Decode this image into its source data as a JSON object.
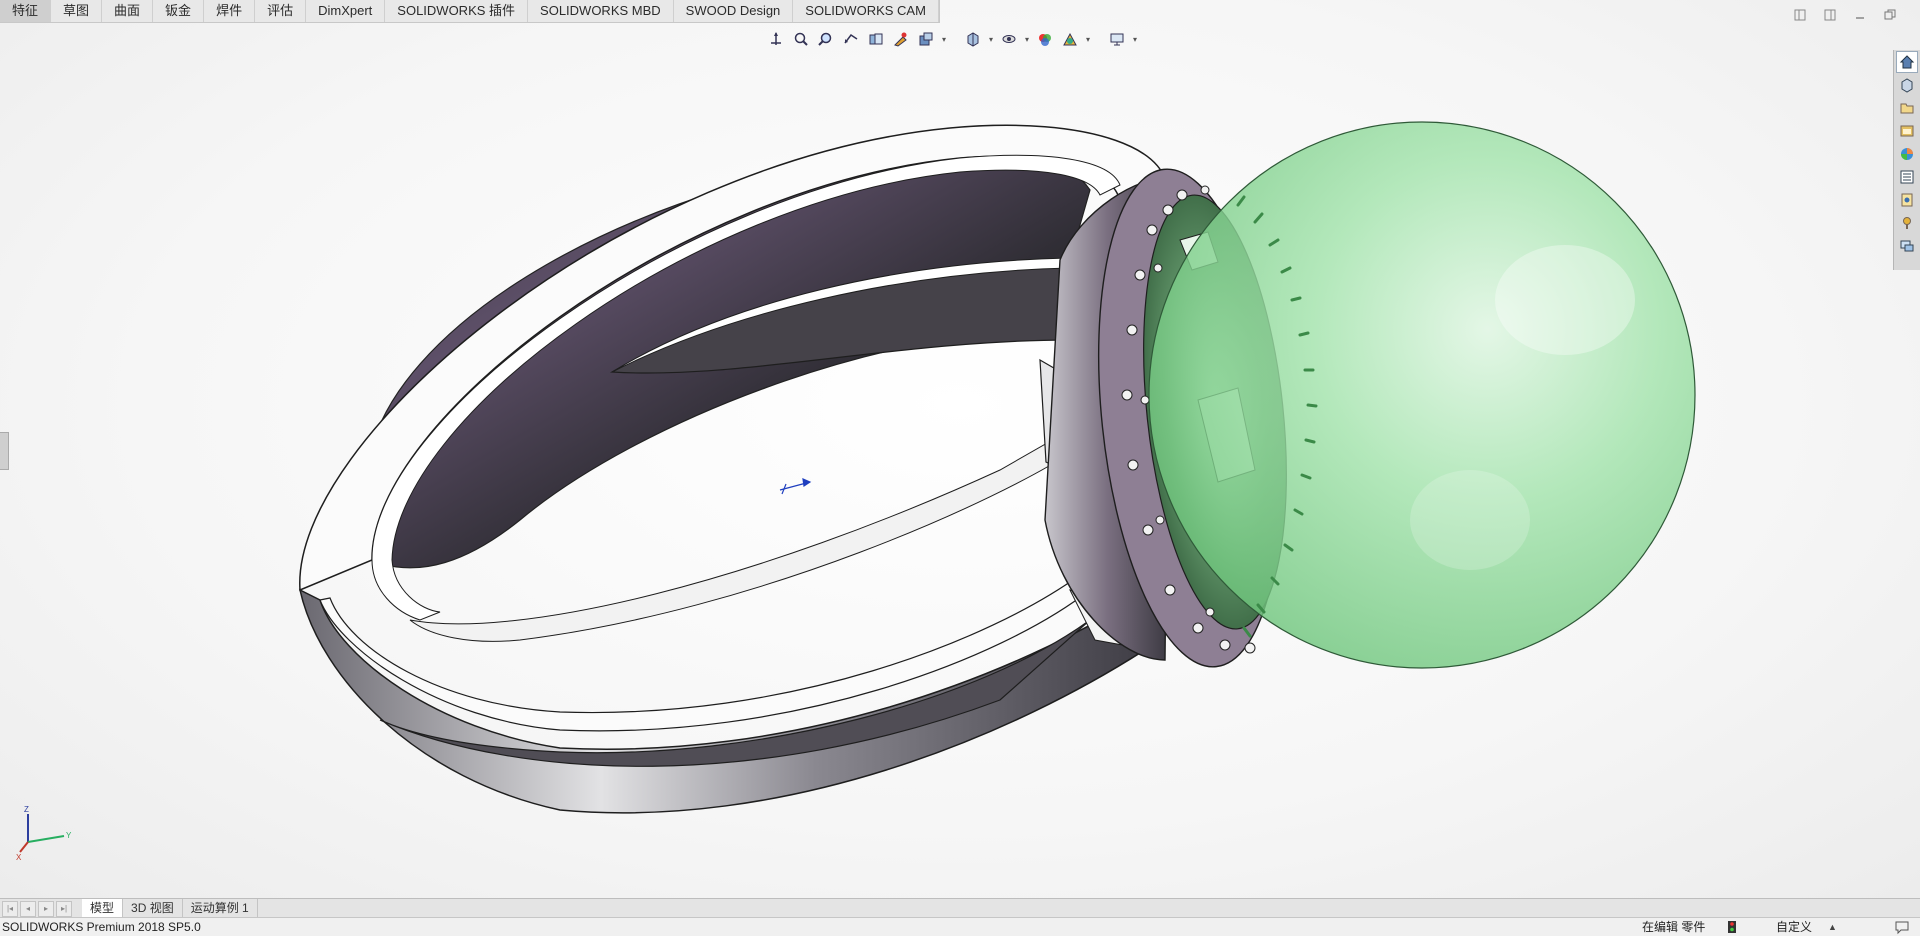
{
  "command_tabs": [
    "特征",
    "草图",
    "曲面",
    "钣金",
    "焊件",
    "评估",
    "DimXpert",
    "SOLIDWORKS 插件",
    "SOLIDWORKS MBD",
    "SWOOD Design",
    "SOLIDWORKS CAM"
  ],
  "active_command_tab": "特征",
  "view_toolbar": [
    "view-orientation-icon",
    "zoom-to-fit-icon",
    "zoom-to-area-icon",
    "previous-view-icon",
    "section-view-icon",
    "dynamic-annotation-icon",
    "view-settings-icon",
    "display-style-icon",
    "hide-show-items-icon",
    "edit-appearance-icon",
    "apply-scene-icon",
    "view-settings-display-icon"
  ],
  "task_pane": [
    "home-icon",
    "solidworks-resources-icon",
    "design-library-icon",
    "file-explorer-icon",
    "view-palette-icon",
    "appearances-scenes-icon",
    "custom-properties-icon",
    "solidworks-forum-icon",
    "solidworks-search-icon"
  ],
  "window_controls": [
    "tile-left-icon",
    "tile-right-icon",
    "minimize-icon",
    "restore-icon"
  ],
  "model_tabs": [
    "模型",
    "3D 视图",
    "运动算例 1"
  ],
  "active_model_tab": "模型",
  "status": {
    "product": "SOLIDWORKS Premium 2018 SP5.0",
    "editing": "在编辑 零件",
    "units": "自定义"
  },
  "triad_axes": [
    "Z",
    "Y",
    "X"
  ],
  "colors": {
    "ring_metal": "#5a5660",
    "bezel_face": "#8e7f94",
    "gem_green": "#8fdc9a",
    "gem_edge": "#3b8a48",
    "axis_x": "#c0392b",
    "axis_y": "#27ae60",
    "axis_z": "#2c3e9e"
  }
}
